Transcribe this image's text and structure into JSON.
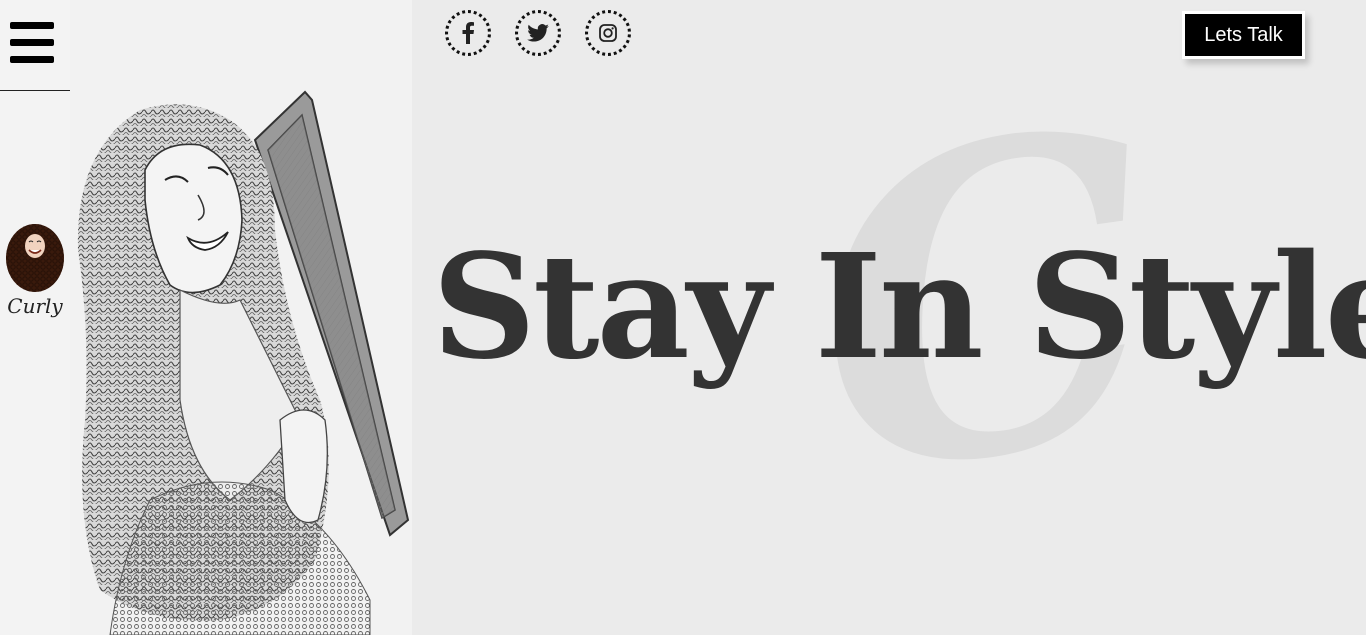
{
  "nav": {
    "menu_icon": "hamburger-menu-icon",
    "logo": {
      "caption": "Curly"
    }
  },
  "social": [
    {
      "name": "facebook",
      "icon": "facebook-icon"
    },
    {
      "name": "twitter",
      "icon": "twitter-icon"
    },
    {
      "name": "instagram",
      "icon": "instagram-icon"
    }
  ],
  "header": {
    "cta_label": "Lets Talk"
  },
  "hero": {
    "title": "Stay In Style",
    "watermark_letter": "C"
  },
  "colors": {
    "background": "#ebebeb",
    "rail": "#f3f3f3",
    "title": "#333333",
    "watermark": "#dcdcdc",
    "cta_bg": "#000000",
    "cta_text": "#ffffff"
  }
}
